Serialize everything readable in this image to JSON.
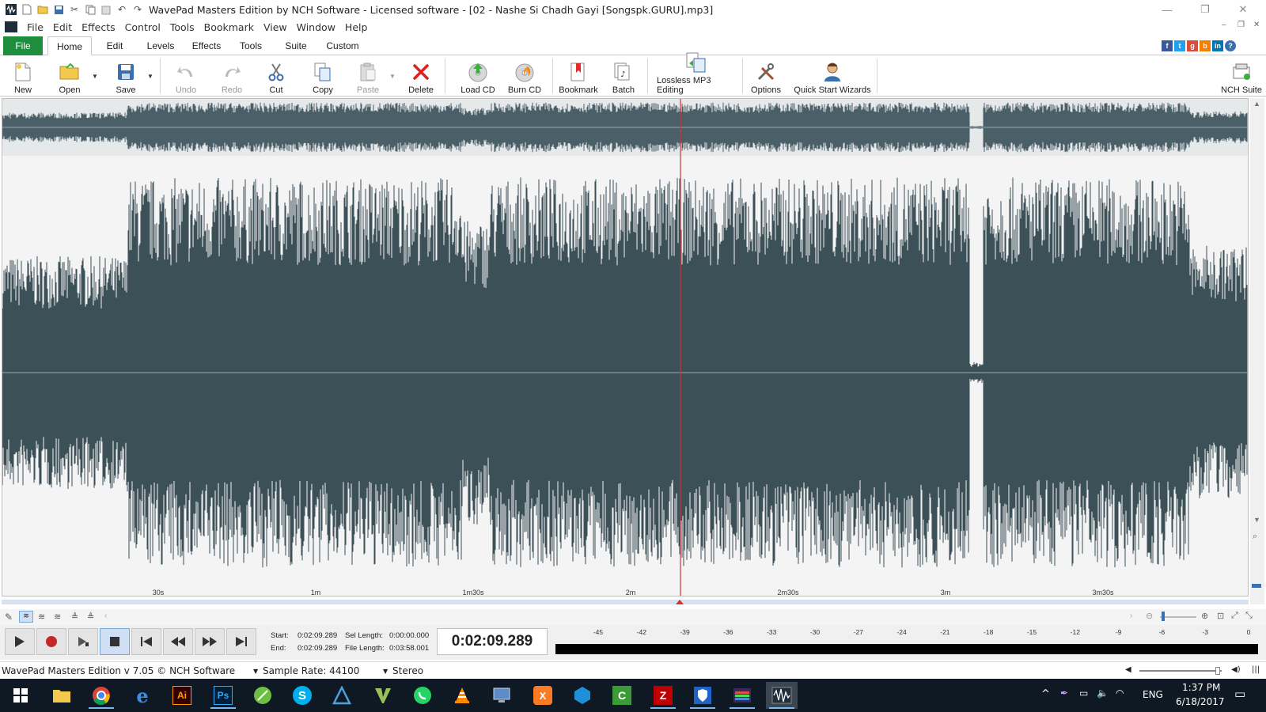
{
  "window": {
    "title": "WavePad Masters Edition by NCH Software - Licensed software - [02 - Nashe Si Chadh Gayi [Songspk.GURU].mp3]"
  },
  "menu": [
    "File",
    "Edit",
    "Effects",
    "Control",
    "Tools",
    "Bookmark",
    "View",
    "Window",
    "Help"
  ],
  "tabs": [
    "File",
    "Home",
    "Edit",
    "Levels",
    "Effects",
    "Tools",
    "Suite",
    "Custom"
  ],
  "ribbon": {
    "new": "New",
    "open": "Open",
    "save": "Save",
    "undo": "Undo",
    "redo": "Redo",
    "cut": "Cut",
    "copy": "Copy",
    "paste": "Paste",
    "delete": "Delete",
    "load_cd": "Load CD",
    "burn_cd": "Burn CD",
    "bookmark": "Bookmark",
    "batch": "Batch",
    "lossless": "Lossless MP3 Editing",
    "options": "Options",
    "wizards": "Quick Start Wizards",
    "nch_suite": "NCH Suite"
  },
  "timeline": [
    "30s",
    "1m",
    "1m30s",
    "2m",
    "2m30s",
    "3m",
    "3m30s"
  ],
  "selection": {
    "start_label": "Start:",
    "start": "0:02:09.289",
    "end_label": "End:",
    "end": "0:02:09.289",
    "sel_length_label": "Sel Length:",
    "sel_length": "0:00:00.000",
    "file_length_label": "File Length:",
    "file_length": "0:03:58.001"
  },
  "current_time": "0:02:09.289",
  "meter_scale": [
    "-45",
    "-42",
    "-39",
    "-36",
    "-33",
    "-30",
    "-27",
    "-24",
    "-21",
    "-18",
    "-15",
    "-12",
    "-9",
    "-6",
    "-3",
    "0"
  ],
  "status": {
    "version": "WavePad Masters Edition v 7.05 © NCH Software",
    "sample_rate": "Sample Rate: 44100",
    "channels": "Stereo"
  },
  "tray": {
    "lang": "ENG",
    "time": "1:37 PM",
    "date": "6/18/2017"
  },
  "colors": {
    "waveform": "#3c5058",
    "cursor": "#d9302c",
    "file_tab": "#1e8e3e",
    "taskbar": "#0f1923"
  }
}
